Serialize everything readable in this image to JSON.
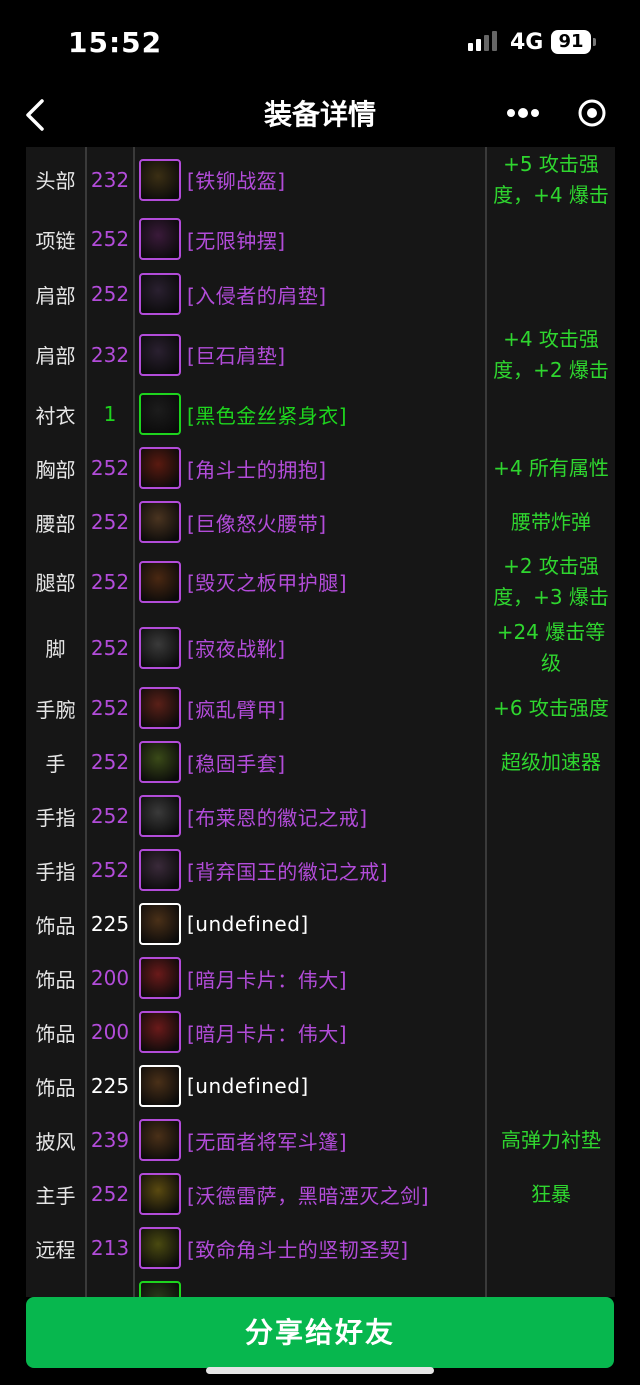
{
  "status_bar": {
    "time": "15:52",
    "network": "4G",
    "battery": "91"
  },
  "nav": {
    "title": "装备详情"
  },
  "colors": {
    "epic": "#b24cd9",
    "uncommon": "#1ed41e",
    "common": "#ffffff",
    "bonus": "#2fd62f",
    "accent": "#07b74e"
  },
  "rows": [
    {
      "slot": "头部",
      "level": "232",
      "name": "[铁铆战盔]",
      "bonus": "+5 攻击强度，+4 爆击",
      "quality": "epic",
      "icon": "helmet-icon",
      "bg": "#3b2f14"
    },
    {
      "slot": "项链",
      "level": "252",
      "name": "[无限钟摆]",
      "bonus": "",
      "quality": "epic",
      "icon": "necklace-icon",
      "bg": "#3a1a3a"
    },
    {
      "slot": "肩部",
      "level": "252",
      "name": "[入侵者的肩垫]",
      "bonus": "",
      "quality": "epic",
      "icon": "shoulder-icon",
      "bg": "#2a2030"
    },
    {
      "slot": "肩部",
      "level": "232",
      "name": "[巨石肩垫]",
      "bonus": "+4 攻击强度，+2 爆击",
      "quality": "epic",
      "icon": "shoulder-icon",
      "bg": "#2a2030"
    },
    {
      "slot": "衬衣",
      "level": "1",
      "name": "[黑色金丝紧身衣]",
      "bonus": "",
      "quality": "uncommon",
      "icon": "shirt-icon",
      "bg": "#1c1c1c"
    },
    {
      "slot": "胸部",
      "level": "252",
      "name": "[角斗士的拥抱]",
      "bonus": "+4 所有属性",
      "quality": "epic",
      "icon": "chest-icon",
      "bg": "#5a1a10"
    },
    {
      "slot": "腰部",
      "level": "252",
      "name": "[巨像怒火腰带]",
      "bonus": "腰带炸弹",
      "quality": "epic",
      "icon": "belt-icon",
      "bg": "#4a3420"
    },
    {
      "slot": "腿部",
      "level": "252",
      "name": "[毁灭之板甲护腿]",
      "bonus": "+2 攻击强度，+3 爆击",
      "quality": "epic",
      "icon": "legs-icon",
      "bg": "#4a2812"
    },
    {
      "slot": "脚",
      "level": "252",
      "name": "[寂夜战靴]",
      "bonus": "+24 爆击等级",
      "quality": "epic",
      "icon": "boots-icon",
      "bg": "#3a3a3a"
    },
    {
      "slot": "手腕",
      "level": "252",
      "name": "[疯乱臂甲]",
      "bonus": "+6 攻击强度",
      "quality": "epic",
      "icon": "bracer-icon",
      "bg": "#5a2018"
    },
    {
      "slot": "手",
      "level": "252",
      "name": "[稳固手套]",
      "bonus": "超级加速器",
      "quality": "epic",
      "icon": "gloves-icon",
      "bg": "#3a4a18"
    },
    {
      "slot": "手指",
      "level": "252",
      "name": "[布莱恩的徽记之戒]",
      "bonus": "",
      "quality": "epic",
      "icon": "ring-icon",
      "bg": "#3a3a3a"
    },
    {
      "slot": "手指",
      "level": "252",
      "name": "[背弃国王的徽记之戒]",
      "bonus": "",
      "quality": "epic",
      "icon": "ring-icon",
      "bg": "#3a2a3a"
    },
    {
      "slot": "饰品",
      "level": "225",
      "name": "[undefined]",
      "bonus": "",
      "quality": "common",
      "icon": "trinket-icon",
      "bg": "#4a3018"
    },
    {
      "slot": "饰品",
      "level": "200",
      "name": "[暗月卡片：伟大]",
      "bonus": "",
      "quality": "epic",
      "icon": "card-icon",
      "bg": "#6a1a1a"
    },
    {
      "slot": "饰品",
      "level": "200",
      "name": "[暗月卡片：伟大]",
      "bonus": "",
      "quality": "epic",
      "icon": "card-icon",
      "bg": "#6a1a1a"
    },
    {
      "slot": "饰品",
      "level": "225",
      "name": "[undefined]",
      "bonus": "",
      "quality": "common",
      "icon": "trinket-icon",
      "bg": "#4a3018"
    },
    {
      "slot": "披风",
      "level": "239",
      "name": "[无面者将军斗篷]",
      "bonus": "高弹力衬垫",
      "quality": "epic",
      "icon": "cloak-icon",
      "bg": "#4a3018"
    },
    {
      "slot": "主手",
      "level": "252",
      "name": "[沃德雷萨，黑暗湮灭之剑]",
      "bonus": "狂暴",
      "quality": "epic",
      "icon": "sword-icon",
      "bg": "#5a4a10"
    },
    {
      "slot": "远程",
      "level": "213",
      "name": "[致命角斗士的坚韧圣契]",
      "bonus": "",
      "quality": "epic",
      "icon": "relic-icon",
      "bg": "#4a4a10"
    },
    {
      "slot": "",
      "level": "",
      "name": "",
      "bonus": "",
      "quality": "uncommon",
      "icon": "item-icon",
      "bg": "#2a3a1a"
    }
  ],
  "footer": {
    "share_label": "分享给好友"
  }
}
